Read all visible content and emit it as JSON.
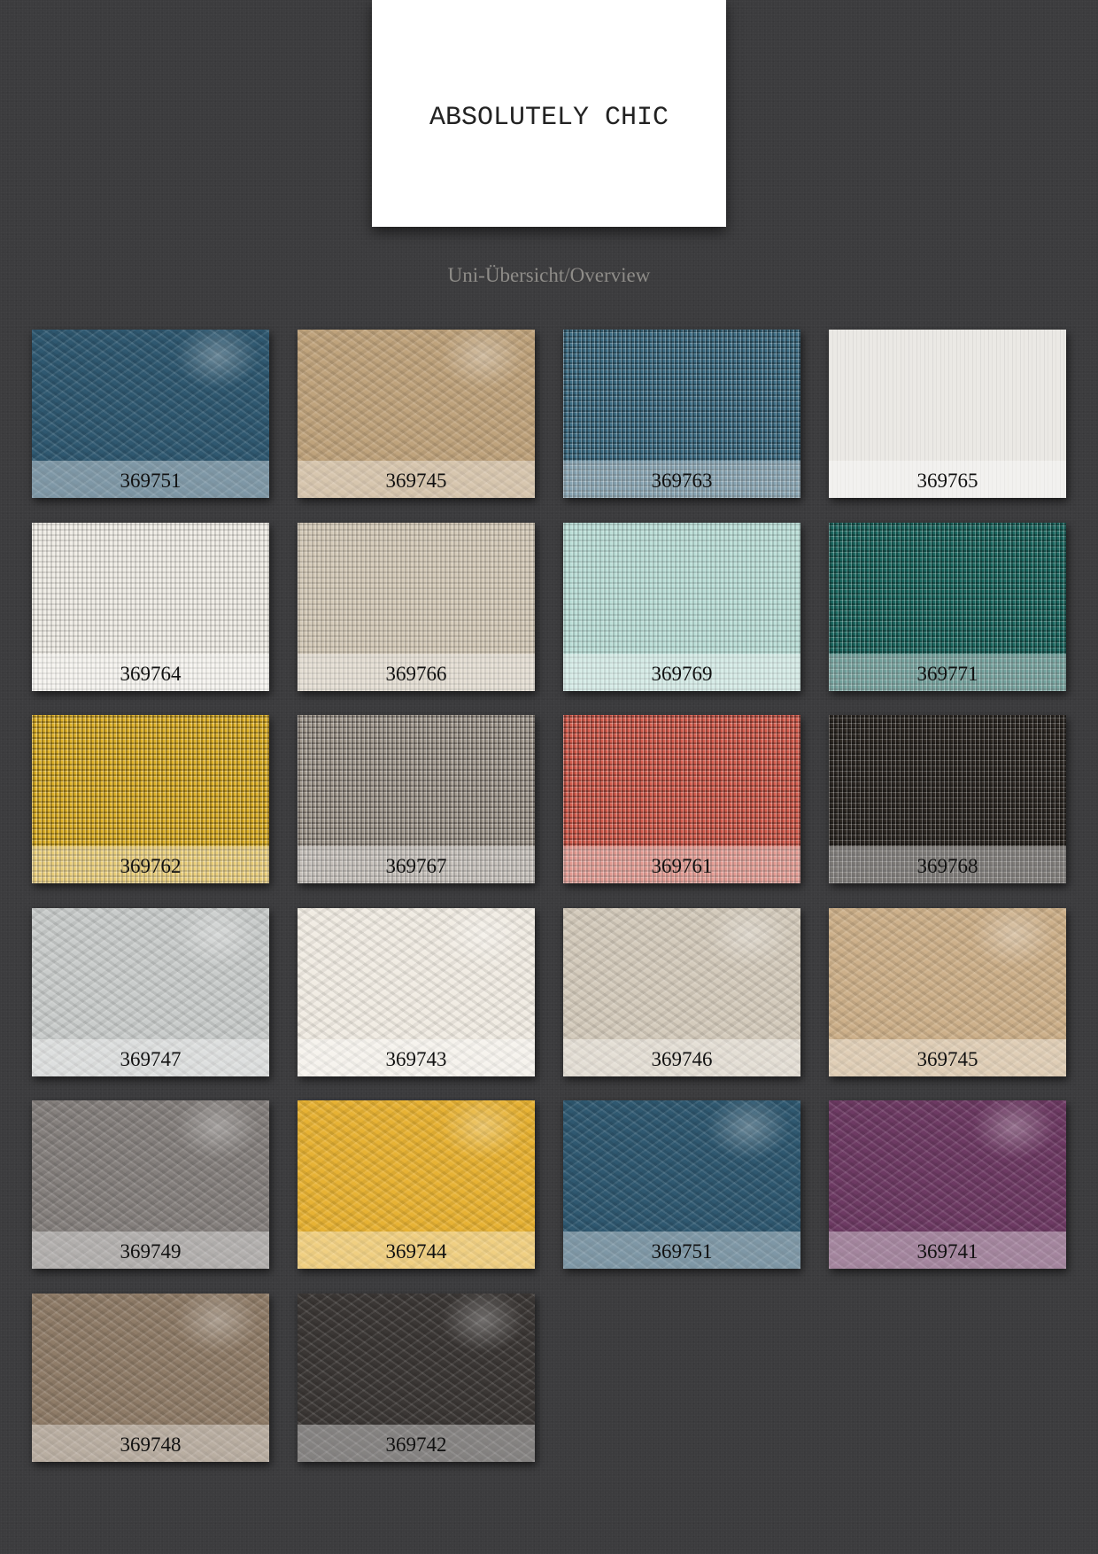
{
  "title": "ABSOLUTELY CHIC",
  "subtitle": "Uni-Übersicht/Overview",
  "swatches": [
    {
      "code": "369751",
      "color": "#2f5870",
      "texture": "leather"
    },
    {
      "code": "369745",
      "color": "#bfa37c",
      "texture": "leather"
    },
    {
      "code": "369763",
      "color": "#3f6f86",
      "texture": "weave-strong"
    },
    {
      "code": "369765",
      "color": "#ebe9e5",
      "texture": "stripe"
    },
    {
      "code": "369764",
      "color": "#f0ede6",
      "texture": "weave"
    },
    {
      "code": "369766",
      "color": "#d6ccba",
      "texture": "weave"
    },
    {
      "code": "369769",
      "color": "#bde0d9",
      "texture": "weave"
    },
    {
      "code": "369771",
      "color": "#1d6a62",
      "texture": "weave-strong"
    },
    {
      "code": "369762",
      "color": "#dfb228",
      "texture": "weave-strong"
    },
    {
      "code": "369767",
      "color": "#a59c91",
      "texture": "weave-strong"
    },
    {
      "code": "369761",
      "color": "#d65e4f",
      "texture": "weave-strong"
    },
    {
      "code": "369768",
      "color": "#2f2a25",
      "texture": "weave-strong"
    },
    {
      "code": "369747",
      "color": "#c9cccb",
      "texture": "leather"
    },
    {
      "code": "369743",
      "color": "#f1ece3",
      "texture": "leather"
    },
    {
      "code": "369746",
      "color": "#d4cbbc",
      "texture": "leather"
    },
    {
      "code": "369745",
      "color": "#cdb08a",
      "texture": "leather"
    },
    {
      "code": "369749",
      "color": "#85807d",
      "texture": "leather"
    },
    {
      "code": "369744",
      "color": "#e7b234",
      "texture": "leather"
    },
    {
      "code": "369751",
      "color": "#2f5870",
      "texture": "leather"
    },
    {
      "code": "369741",
      "color": "#6d3a63",
      "texture": "leather"
    },
    {
      "code": "369748",
      "color": "#8f7c68",
      "texture": "leather"
    },
    {
      "code": "369742",
      "color": "#3b3735",
      "texture": "leather"
    }
  ]
}
